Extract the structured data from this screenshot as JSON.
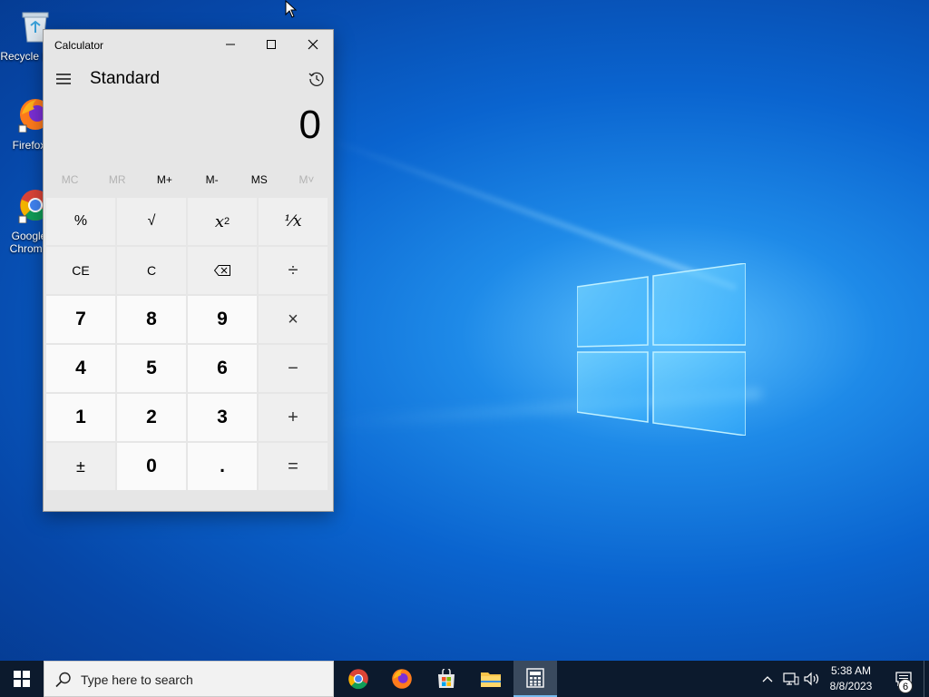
{
  "desktop": {
    "icons": [
      {
        "label": "Recycle Bin",
        "icon": "recycle-bin-icon"
      },
      {
        "label": "Firefox",
        "icon": "firefox-icon"
      },
      {
        "label": "Google Chrome",
        "icon": "chrome-icon"
      }
    ]
  },
  "calculator": {
    "window_title": "Calculator",
    "mode": "Standard",
    "display_value": "0",
    "memory": [
      {
        "label": "MC",
        "enabled": false
      },
      {
        "label": "MR",
        "enabled": false
      },
      {
        "label": "M+",
        "enabled": true
      },
      {
        "label": "M-",
        "enabled": true
      },
      {
        "label": "MS",
        "enabled": true
      },
      {
        "label": "M˅",
        "enabled": false
      }
    ],
    "keys": {
      "percent": "%",
      "sqrt": "√",
      "square_base": "x",
      "square_exp": "2",
      "reciprocal": "⅟x",
      "ce": "CE",
      "c": "C",
      "divide": "÷",
      "seven": "7",
      "eight": "8",
      "nine": "9",
      "multiply": "×",
      "four": "4",
      "five": "5",
      "six": "6",
      "minus": "−",
      "one": "1",
      "two": "2",
      "three": "3",
      "plus": "+",
      "negate": "±",
      "zero": "0",
      "decimal": ".",
      "equals": "="
    }
  },
  "taskbar": {
    "search_placeholder": "Type here to search",
    "apps": [
      "chrome-icon",
      "firefox-icon",
      "store-icon",
      "file-explorer-icon",
      "calculator-icon"
    ],
    "clock_time": "5:38 AM",
    "clock_date": "8/8/2023",
    "notification_count": "6"
  },
  "colors": {
    "desktop_accent": "#0a64cf",
    "taskbar_bg": "#0c1a2d",
    "calc_bg": "#e6e6e6"
  }
}
